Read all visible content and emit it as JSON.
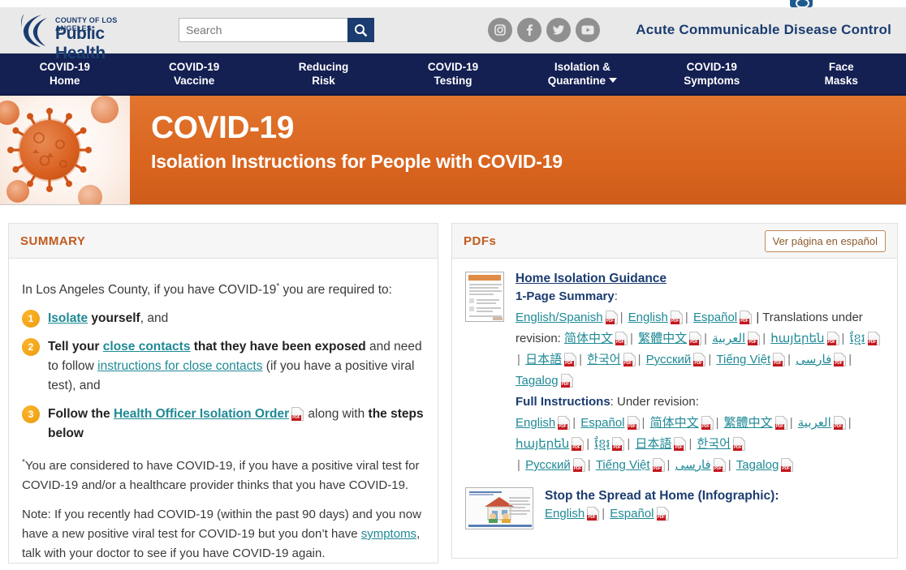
{
  "header": {
    "logo_line1": "COUNTY OF LOS ANGELES",
    "logo_line2": "Public Health",
    "search_placeholder": "Search",
    "search_value": "",
    "search_button_icon": "search-icon",
    "social": [
      {
        "name": "instagram",
        "glyph": "▣"
      },
      {
        "name": "facebook",
        "glyph": "f"
      },
      {
        "name": "twitter",
        "glyph": "ᵗ"
      },
      {
        "name": "youtube",
        "glyph": "▶"
      }
    ],
    "department_title": "Acute Communicable Disease Control"
  },
  "nav": {
    "items": [
      {
        "line1": "COVID-19",
        "line2": "Home",
        "has_caret": false
      },
      {
        "line1": "COVID-19",
        "line2": "Vaccine",
        "has_caret": false
      },
      {
        "line1": "Reducing",
        "line2": "Risk",
        "has_caret": false
      },
      {
        "line1": "COVID-19",
        "line2": "Testing",
        "has_caret": false
      },
      {
        "line1": "Isolation &",
        "line2": "Quarantine",
        "has_caret": true
      },
      {
        "line1": "COVID-19",
        "line2": "Symptoms",
        "has_caret": false
      },
      {
        "line1": "Face",
        "line2": "Masks",
        "has_caret": false
      }
    ]
  },
  "banner": {
    "title": "COVID-19",
    "subtitle": "Isolation Instructions for People with COVID-19",
    "image_alt": "coronavirus-illustration",
    "bg_color": "#d9651f"
  },
  "summary": {
    "panel_title": "SUMMARY",
    "intro_before": "In Los Angeles County, if you have COVID-19",
    "intro_star": "*",
    "intro_after": " you are required to:",
    "steps": [
      {
        "number": "1",
        "parts": [
          {
            "t": "Isolate",
            "style": "link-bold"
          },
          {
            "t": " yourself",
            "style": "bold"
          },
          {
            "t": ", and",
            "style": "plain"
          }
        ]
      },
      {
        "number": "2",
        "parts": [
          {
            "t": "Tell your ",
            "style": "bold"
          },
          {
            "t": "close contacts",
            "style": "link-bold"
          },
          {
            "t": " that they have been exposed",
            "style": "bold"
          },
          {
            "t": " and need to follow ",
            "style": "plain"
          },
          {
            "t": "instructions for close contacts",
            "style": "link"
          },
          {
            "t": " (if you have a positive viral test), and",
            "style": "plain"
          }
        ]
      },
      {
        "number": "3",
        "parts": [
          {
            "t": "Follow the ",
            "style": "bold"
          },
          {
            "t": "Health Officer Isolation Order",
            "style": "link-bold"
          },
          {
            "t": "PDF",
            "style": "pdf"
          },
          {
            "t": " along with ",
            "style": "plain"
          },
          {
            "t": "the steps below",
            "style": "bold"
          }
        ]
      }
    ],
    "footnote_star": "*",
    "footnote": "You are considered to have COVID-19, if you have a positive viral test for COVID-19 and/or a healthcare provider thinks that you have COVID-19.",
    "note_before": "Note: If you recently had COVID-19 (within the past 90 days) and you now have a new positive viral test for COVID-19 but you don’t have ",
    "note_link": "symptoms",
    "note_after": ", talk with your doctor to see if you have COVID-19 again."
  },
  "pdfs": {
    "panel_title": "PDFs",
    "spanish_button": "Ver página en español",
    "docs": [
      {
        "thumb": "home-isolation-guidance-thumbnail",
        "title": "Home Isolation Guidance",
        "sections": [
          {
            "label": "1-Page Summary",
            "label_suffix": ":",
            "links": [
              "English/Spanish",
              "English",
              "Español"
            ],
            "trailing_text": "| Translations under revision:",
            "links2": [
              "简体中文",
              "繁體中文",
              "العربية",
              "հայերեն",
              "ខ្មែរ",
              "日本語",
              "한국어",
              "Русский",
              "Tiếng Việt",
              "فارسی",
              "Tagalog"
            ]
          },
          {
            "label": "Full Instructions",
            "label_suffix": ": Under revision:",
            "links": [],
            "trailing_text": "",
            "links2": [
              "English",
              "Español",
              "简体中文",
              "繁體中文",
              "العربية",
              "հայերեն",
              "ខ្មែរ",
              "日本語",
              "한국어",
              "Русский",
              "Tiếng Việt",
              "فارسی",
              "Tagalog"
            ]
          }
        ]
      },
      {
        "thumb": "stop-the-spread-at-home-thumbnail",
        "title": "Stop the Spread at Home (Infographic):",
        "sections": [
          {
            "label": "",
            "label_suffix": "",
            "links": [],
            "trailing_text": "",
            "links2": [
              "English",
              "Español"
            ]
          }
        ]
      }
    ]
  },
  "colors": {
    "nav_blue": "#141f52",
    "brand_blue": "#1b3c70",
    "banner_orange": "#d9651f",
    "heading_orange": "#c05a1e",
    "link_teal": "#1f8a96",
    "bullet_amber": "#f0a316"
  }
}
